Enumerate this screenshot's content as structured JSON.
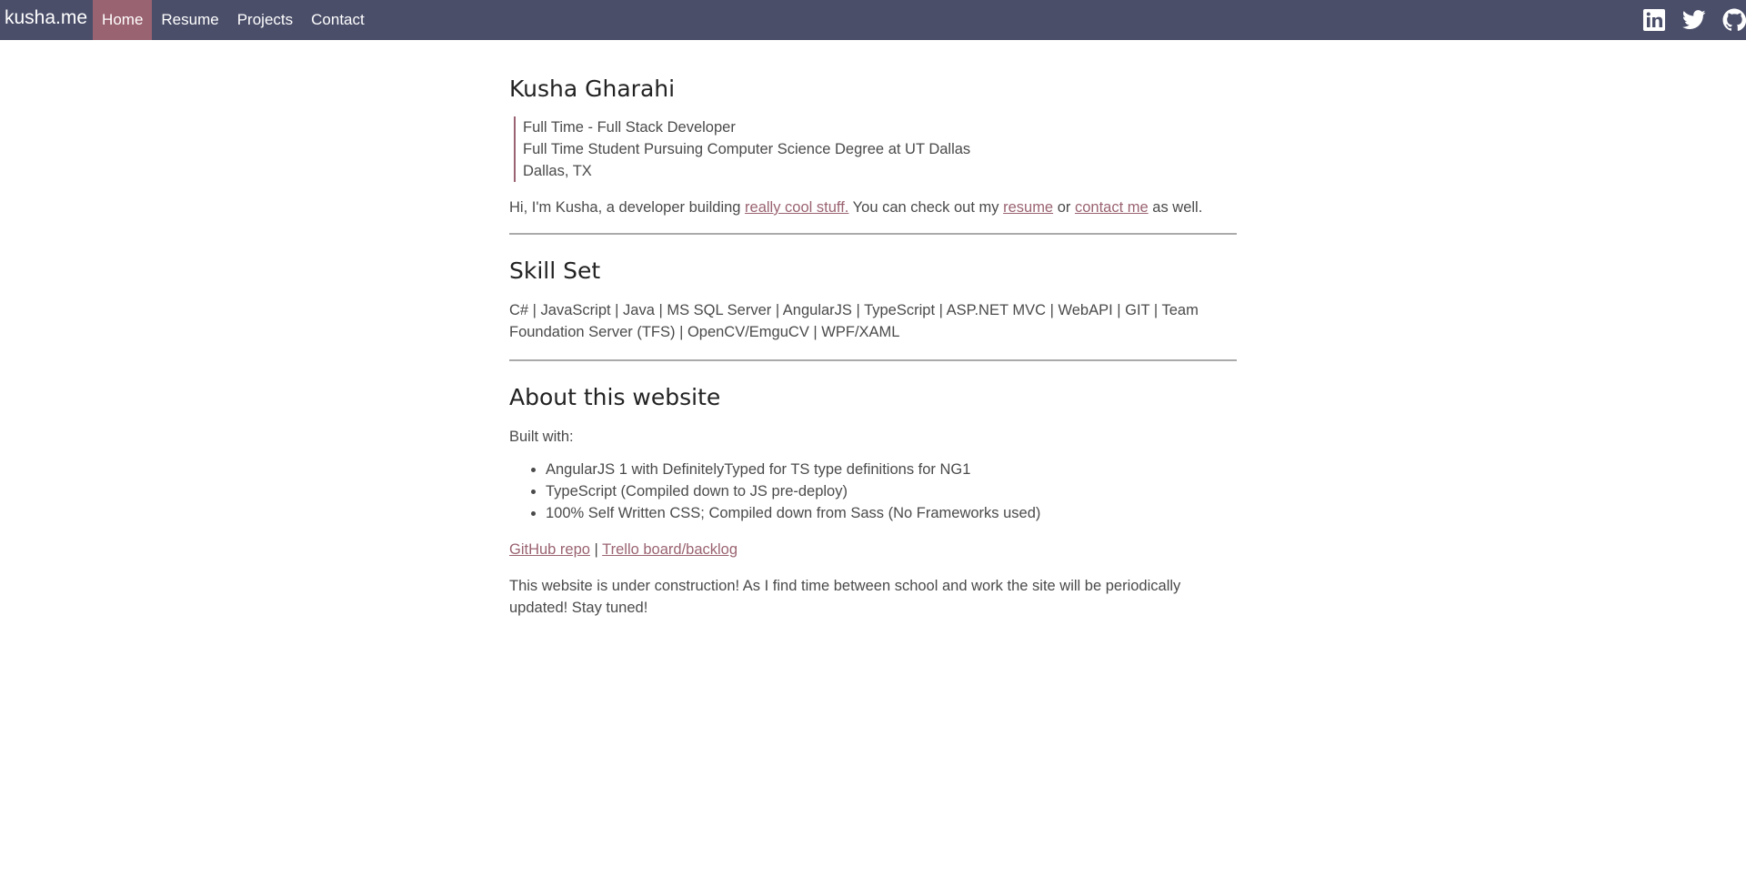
{
  "nav": {
    "brand": "kusha.me",
    "items": [
      {
        "label": "Home",
        "active": true
      },
      {
        "label": "Resume",
        "active": false
      },
      {
        "label": "Projects",
        "active": false
      },
      {
        "label": "Contact",
        "active": false
      }
    ],
    "social_icons": [
      "linkedin-icon",
      "twitter-icon",
      "github-icon"
    ]
  },
  "intro": {
    "name": "Kusha Gharahi",
    "tagline": [
      "Full Time - Full Stack Developer",
      "Full Time Student Pursuing Computer Science Degree at UT Dallas",
      "Dallas, TX"
    ],
    "text_before_link1": "Hi, I'm Kusha, a developer building ",
    "link1": "really cool stuff.",
    "text_between1": " You can check out my ",
    "link2": "resume",
    "text_between2": " or ",
    "link3": "contact me",
    "text_after": " as well."
  },
  "skills": {
    "title": "Skill Set",
    "text": "C# | JavaScript | Java | MS SQL Server | AngularJS | TypeScript | ASP.NET MVC | WebAPI | GIT | Team Foundation Server (TFS) | OpenCV/EmguCV | WPF/XAML"
  },
  "about": {
    "title": "About this website",
    "built_with": "Built with:",
    "items": [
      "AngularJS 1 with DefinitelyTyped for TS type definitions for NG1",
      "TypeScript (Compiled down to JS pre-deploy)",
      "100% Self Written CSS; Compiled down from Sass (No Frameworks used)"
    ],
    "link_github": "GitHub repo",
    "separator": " | ",
    "link_trello": "Trello board/backlog",
    "construction_note": "This website is under construction! As I find time between school and work the site will be periodically updated! Stay tuned!"
  },
  "colors": {
    "navbar": "#4a4e69",
    "active_nav": "#9a6371",
    "link": "#9a6371"
  }
}
